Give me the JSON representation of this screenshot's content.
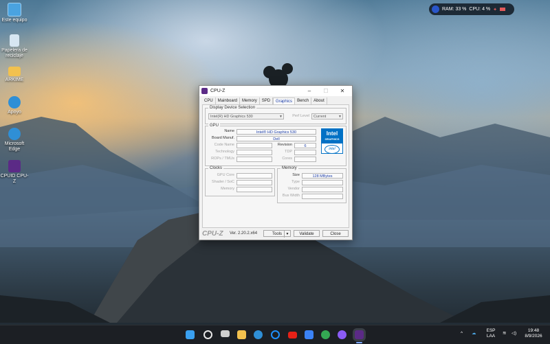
{
  "desktop": {
    "icons": [
      {
        "label": "Este equipo",
        "icon": "monitor-icon",
        "color": "#4aa3e0"
      },
      {
        "label": "Papelera de reciclaje",
        "icon": "recycle-bin-icon",
        "color": "#d6e6f2"
      },
      {
        "label": "ARKIME",
        "icon": "folder-icon",
        "color": "#f2c14e"
      },
      {
        "label": "Apoyo",
        "icon": "edge-icon",
        "color": "#2f8fd6"
      },
      {
        "label": "Microsoft Edge",
        "icon": "edge-icon",
        "color": "#2f8fd6"
      },
      {
        "label": "CPUID CPU-Z",
        "icon": "cpuz-icon",
        "color": "#5b2a86"
      }
    ]
  },
  "tray_widget": {
    "ram": "RAM: 33 %",
    "cpu": "CPU: 4 %"
  },
  "window": {
    "title": "CPU-Z",
    "tabs": [
      "CPU",
      "Mainboard",
      "Memory",
      "SPD",
      "Graphics",
      "Bench",
      "About"
    ],
    "active_tab": "Graphics",
    "display_device": {
      "group_label": "Display Device Selection",
      "device": "Intel(R) HD Graphics 530",
      "perf_level_label": "Perf Level",
      "perf_level": "Current"
    },
    "gpu": {
      "group_label": "GPU",
      "name_label": "Name",
      "name": "Intel® HD Graphics 530",
      "board_manuf_label": "Board Manuf.",
      "board_manuf": "Dell",
      "code_name_label": "Code Name",
      "revision_label": "Revision",
      "revision": "6",
      "technology_label": "Technology",
      "tdp_label": "TDP",
      "rops_label": "ROPs / TMUs",
      "cores_label": "Cores",
      "logo_text": "Intel",
      "logo_sub": "GRAPHICS",
      "logo_badge": "intel"
    },
    "clocks": {
      "group_label": "Clocks",
      "gpu_core_label": "GPU Core",
      "shader_label": "Shader / SoC",
      "memory_label": "Memory"
    },
    "memory": {
      "group_label": "Memory",
      "size_label": "Size",
      "size": "128 MBytes",
      "type_label": "Type",
      "vendor_label": "Vendor",
      "bus_width_label": "Bus Width"
    },
    "footer": {
      "brand": "CPU-Z",
      "version": "Ver. 2.20.2.x64",
      "tools_label": "Tools",
      "validate_label": "Validate",
      "close_label": "Close"
    }
  },
  "taskbar": {
    "icons": [
      {
        "name": "start-icon",
        "color": "#3aa0f0"
      },
      {
        "name": "search-icon",
        "color": "#e8e8e8"
      },
      {
        "name": "task-view-icon",
        "color": "#cfcfcf"
      },
      {
        "name": "file-explorer-icon",
        "color": "#f2c14e"
      },
      {
        "name": "edge-icon",
        "color": "#2f8fd6"
      },
      {
        "name": "cortana-icon",
        "color": "#1e90ff"
      },
      {
        "name": "youtube-icon",
        "color": "#e62117"
      },
      {
        "name": "store-icon",
        "color": "#3b82f6"
      },
      {
        "name": "chrome-icon",
        "color": "#34a853"
      },
      {
        "name": "copilot-icon",
        "color": "#8b5cf6"
      },
      {
        "name": "cpuz-icon",
        "color": "#5b2a86"
      }
    ],
    "lang_top": "ESP",
    "lang_bottom": "LAA",
    "time": "19:48",
    "date": "8/9/2026"
  }
}
